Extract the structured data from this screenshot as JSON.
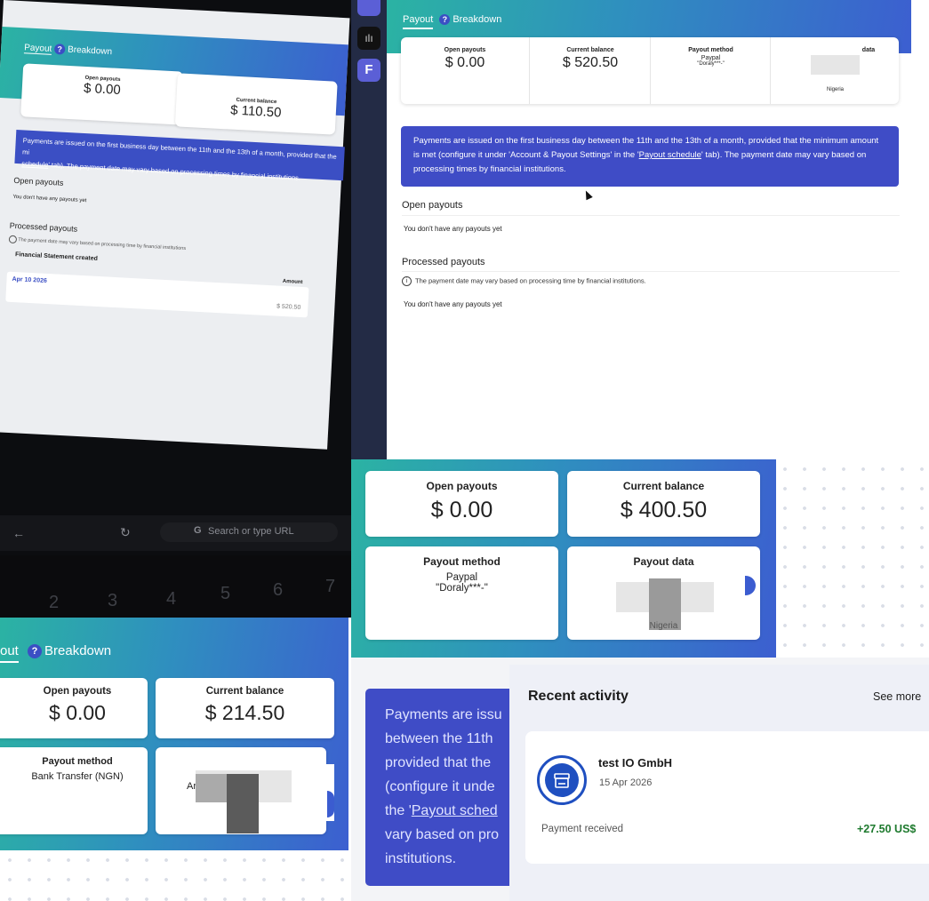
{
  "photo_left": {
    "tab_payout": "Payout",
    "tab_breakdown": "Breakdown",
    "open_payouts_label": "Open payouts",
    "open_payouts_value": "$ 0.00",
    "current_balance_label": "Current balance",
    "current_balance_value": "$ 110.50",
    "notice": "Payments are issued on the first business day between the 11th and the 13th of a month, provided that the mi",
    "notice_line2_link": "schedule",
    "notice_line2_rest": "' tab). The payment date may vary based on processing times by financial institutions.",
    "open_heading": "Open payouts",
    "open_empty": "You don't have any payouts yet",
    "processed_heading": "Processed payouts",
    "processed_info": "The payment date may vary based on processing time by financial institutions",
    "statement_label": "Financial Statement created",
    "amount_header": "Amount",
    "row_date": "Apr 10 2026",
    "row_amount": "$ 520.50",
    "url_placeholder": "Search or type URL",
    "keys": [
      "2",
      "3",
      "4",
      "5",
      "6",
      "7"
    ]
  },
  "screen_top_right": {
    "tab_payout": "Payout",
    "tab_breakdown": "Breakdown",
    "sidebar_letter": "F",
    "cards": [
      {
        "label": "Open payouts",
        "value": "$ 0.00"
      },
      {
        "label": "Current balance",
        "value": "$ 520.50"
      },
      {
        "label": "Payout method",
        "value": "Paypal",
        "sub": "\"Doraly***-\""
      },
      {
        "label": "data",
        "value": "Nigeria"
      }
    ],
    "notice_part1": "Payments are issued on the first business day between the 11th and the 13th of a month, provided that the minimum amount is met (configure it under 'Account & Payout Settings' in the '",
    "notice_link": "Payout schedule",
    "notice_part2": "' tab). The payment date may vary based on processing times by financial institutions.",
    "open_heading": "Open payouts",
    "open_empty": "You don't have any payouts yet",
    "processed_heading": "Processed payouts",
    "processed_info": "The payment date may vary based on processing time by financial institutions.",
    "processed_empty": "You don't have any payouts yet"
  },
  "mid_right": {
    "cards": [
      {
        "label": "Open payouts",
        "value": "$ 0.00"
      },
      {
        "label": "Current balance",
        "value": "$ 400.50"
      },
      {
        "label": "Payout method",
        "value": "Paypal",
        "sub": "\"Doraly***-\""
      },
      {
        "label": "Payout data",
        "value": "Nigeria"
      }
    ]
  },
  "bottom_left": {
    "tab_payout": "out",
    "tab_breakdown": "Breakdown",
    "cards": [
      {
        "label": "Open payouts",
        "value": "$ 0.00"
      },
      {
        "label": "Current balance",
        "value": "$ 214.50"
      },
      {
        "label": "Payout method",
        "value": "Bank Transfer (NGN)"
      },
      {
        "label": "",
        "value": "Ar"
      }
    ]
  },
  "bottom_right": {
    "notice_lines": [
      "Payments are issu",
      "between the 11th",
      "provided that the",
      "(configure it unde",
      "the '",
      "vary based on pro",
      "institutions."
    ],
    "notice_link": "Payout sched",
    "activity_title": "Recent activity",
    "see_more": "See more",
    "merchant": "test IO GmbH",
    "date": "15 Apr 2026",
    "status": "Payment received",
    "amount": "+27.50 US$",
    "amount_color": "#1e7a2e"
  }
}
